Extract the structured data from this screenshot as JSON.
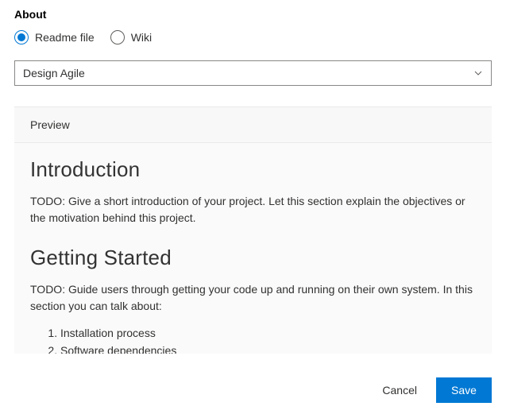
{
  "section": {
    "title": "About"
  },
  "radios": {
    "readme": "Readme file",
    "wiki": "Wiki"
  },
  "dropdown": {
    "selected": "Design Agile"
  },
  "preview": {
    "tab": "Preview",
    "intro_heading": "Introduction",
    "intro_text": "TODO: Give a short introduction of your project. Let this section explain the objectives or the motivation behind this project.",
    "started_heading": "Getting Started",
    "started_text": "TODO: Guide users through getting your code up and running on their own system. In this section you can talk about:",
    "list": {
      "0": "Installation process",
      "1": "Software dependencies"
    }
  },
  "buttons": {
    "cancel": "Cancel",
    "save": "Save"
  }
}
